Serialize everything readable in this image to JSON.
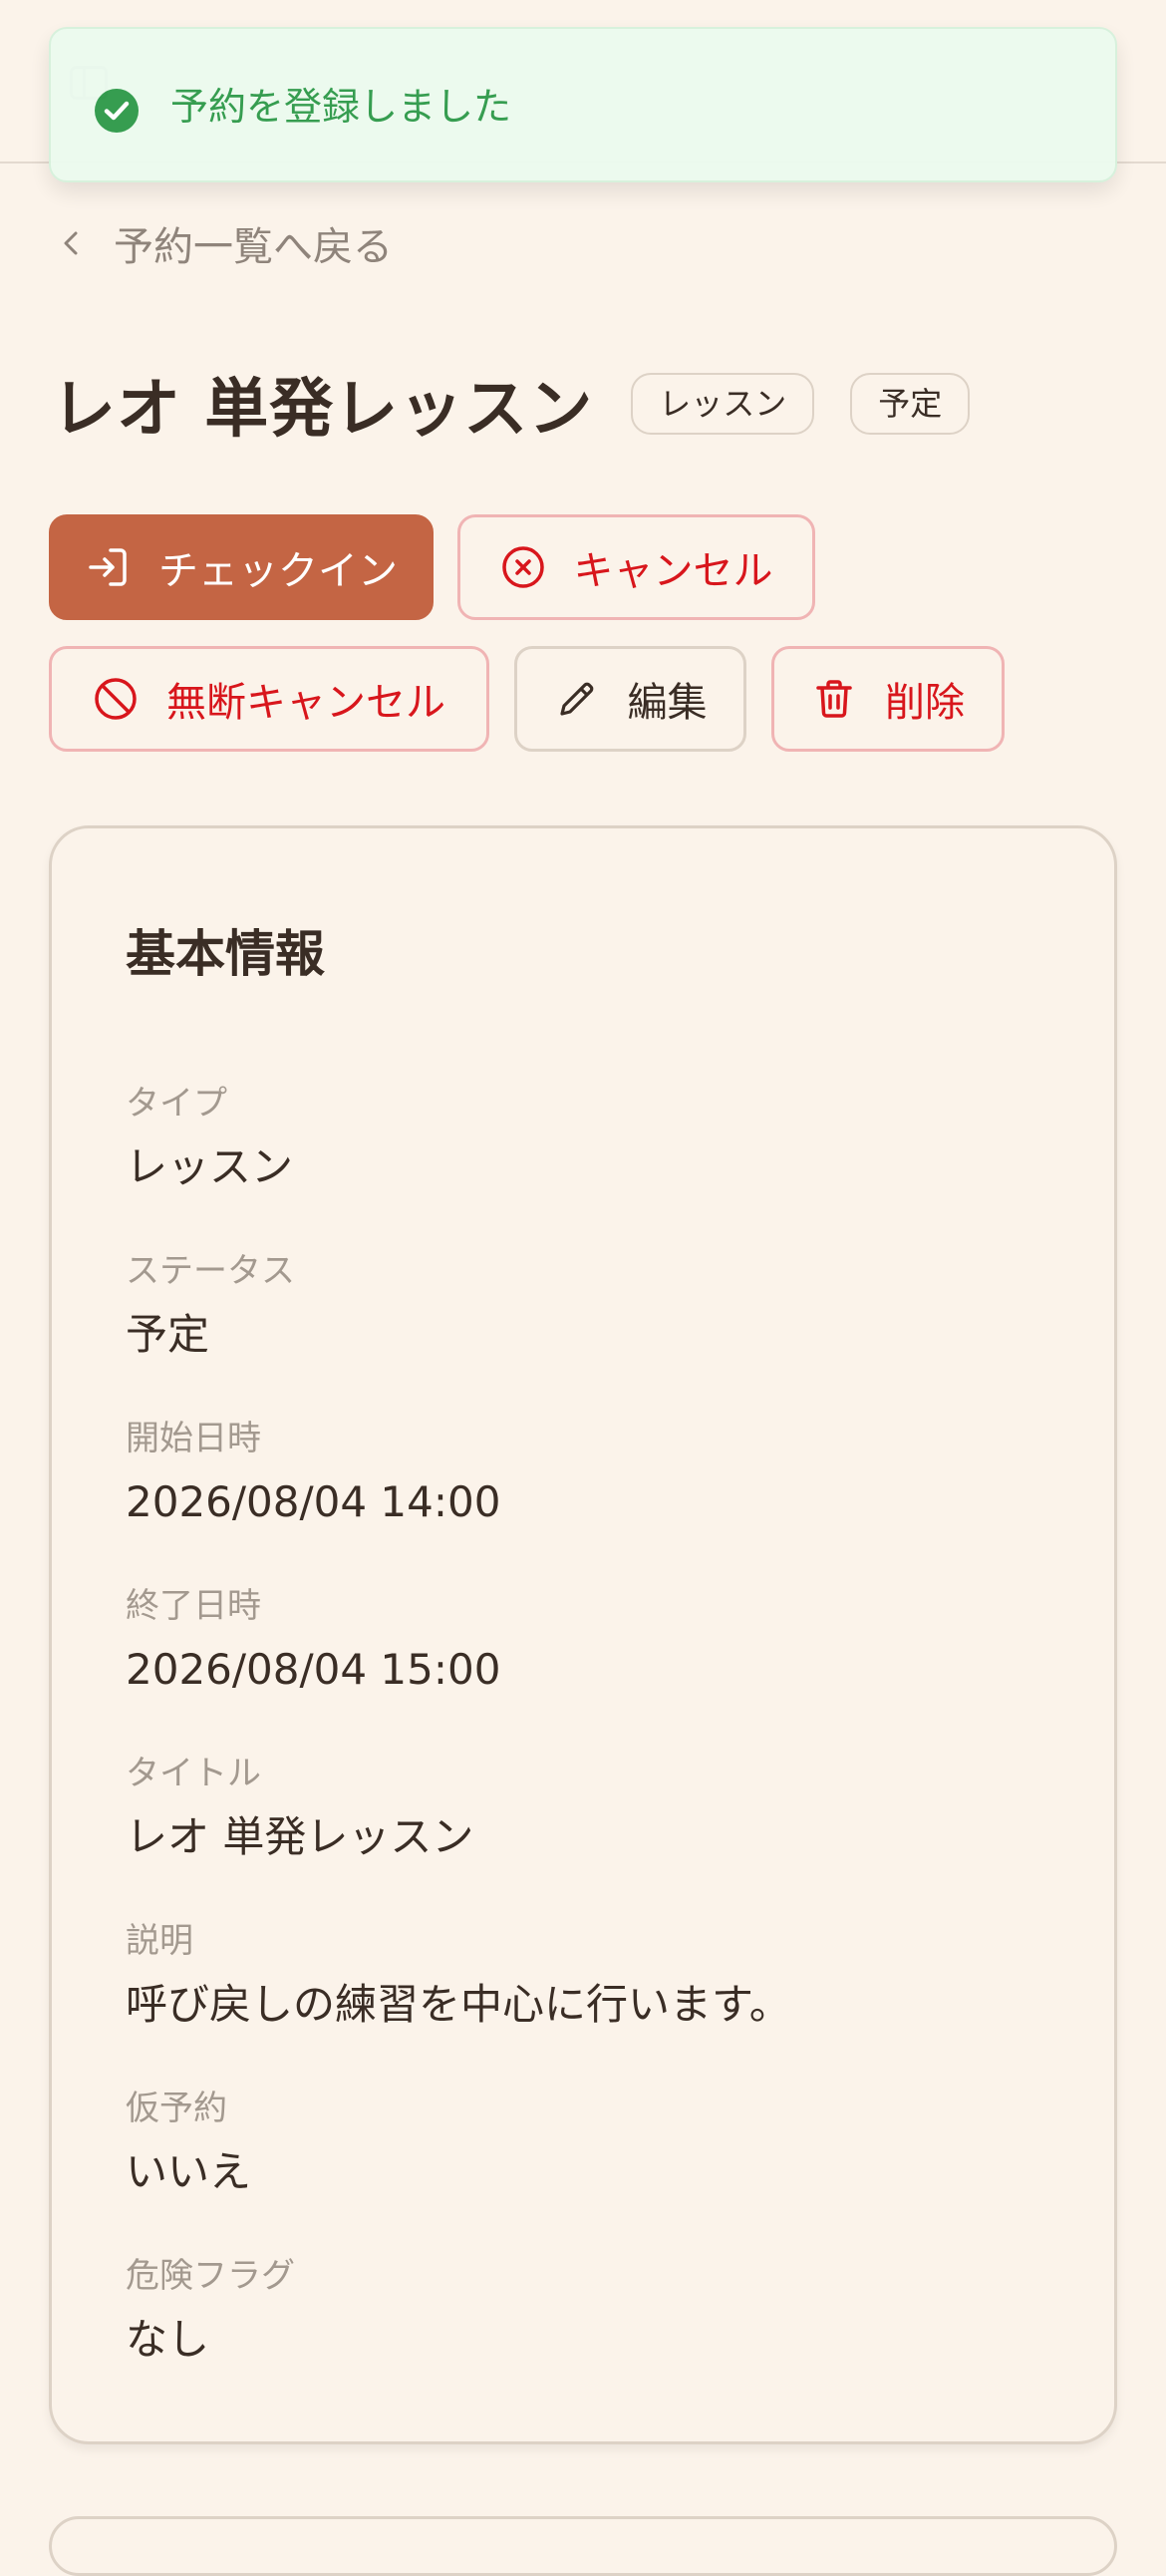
{
  "toast": {
    "message": "予約を登録しました",
    "icon": "check-circle-icon",
    "color": "#2e9a4a"
  },
  "nav": {
    "back_label": "予約一覧へ戻る"
  },
  "header": {
    "title": "レオ 単発レッスン",
    "badges": [
      "レッスン",
      "予定"
    ]
  },
  "actions": {
    "checkin": "チェックイン",
    "cancel": "キャンセル",
    "no_show_cancel": "無断キャンセル",
    "edit": "編集",
    "delete": "削除"
  },
  "colors": {
    "primary": "#c46544",
    "danger": "#d8161c",
    "background": "#fbf3ea"
  },
  "basic_info": {
    "title": "基本情報",
    "fields": [
      {
        "label": "タイプ",
        "value": "レッスン"
      },
      {
        "label": "ステータス",
        "value": "予定"
      },
      {
        "label": "開始日時",
        "value": "2026/08/04 14:00"
      },
      {
        "label": "終了日時",
        "value": "2026/08/04 15:00"
      },
      {
        "label": "タイトル",
        "value": "レオ 単発レッスン"
      },
      {
        "label": "説明",
        "value": "呼び戻しの練習を中心に行います。"
      },
      {
        "label": "仮予約",
        "value": "いいえ"
      },
      {
        "label": "危険フラグ",
        "value": "なし"
      }
    ]
  }
}
